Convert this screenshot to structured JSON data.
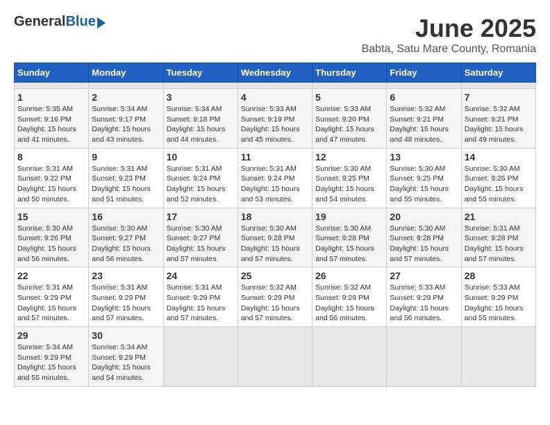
{
  "header": {
    "logo_general": "General",
    "logo_blue": "Blue",
    "month_title": "June 2025",
    "location": "Babta, Satu Mare County, Romania"
  },
  "calendar": {
    "days_of_week": [
      "Sunday",
      "Monday",
      "Tuesday",
      "Wednesday",
      "Thursday",
      "Friday",
      "Saturday"
    ],
    "weeks": [
      [
        {
          "num": "",
          "empty": true
        },
        {
          "num": "",
          "empty": true
        },
        {
          "num": "",
          "empty": true
        },
        {
          "num": "",
          "empty": true
        },
        {
          "num": "",
          "empty": true
        },
        {
          "num": "",
          "empty": true
        },
        {
          "num": "",
          "empty": true
        }
      ],
      [
        {
          "num": "1",
          "sunrise": "Sunrise: 5:35 AM",
          "sunset": "Sunset: 9:16 PM",
          "daylight": "Daylight: 15 hours and 41 minutes."
        },
        {
          "num": "2",
          "sunrise": "Sunrise: 5:34 AM",
          "sunset": "Sunset: 9:17 PM",
          "daylight": "Daylight: 15 hours and 43 minutes."
        },
        {
          "num": "3",
          "sunrise": "Sunrise: 5:34 AM",
          "sunset": "Sunset: 9:18 PM",
          "daylight": "Daylight: 15 hours and 44 minutes."
        },
        {
          "num": "4",
          "sunrise": "Sunrise: 5:33 AM",
          "sunset": "Sunset: 9:19 PM",
          "daylight": "Daylight: 15 hours and 45 minutes."
        },
        {
          "num": "5",
          "sunrise": "Sunrise: 5:33 AM",
          "sunset": "Sunset: 9:20 PM",
          "daylight": "Daylight: 15 hours and 47 minutes."
        },
        {
          "num": "6",
          "sunrise": "Sunrise: 5:32 AM",
          "sunset": "Sunset: 9:21 PM",
          "daylight": "Daylight: 15 hours and 48 minutes."
        },
        {
          "num": "7",
          "sunrise": "Sunrise: 5:32 AM",
          "sunset": "Sunset: 9:21 PM",
          "daylight": "Daylight: 15 hours and 49 minutes."
        }
      ],
      [
        {
          "num": "8",
          "sunrise": "Sunrise: 5:31 AM",
          "sunset": "Sunset: 9:22 PM",
          "daylight": "Daylight: 15 hours and 50 minutes."
        },
        {
          "num": "9",
          "sunrise": "Sunrise: 5:31 AM",
          "sunset": "Sunset: 9:23 PM",
          "daylight": "Daylight: 15 hours and 51 minutes."
        },
        {
          "num": "10",
          "sunrise": "Sunrise: 5:31 AM",
          "sunset": "Sunset: 9:24 PM",
          "daylight": "Daylight: 15 hours and 52 minutes."
        },
        {
          "num": "11",
          "sunrise": "Sunrise: 5:31 AM",
          "sunset": "Sunset: 9:24 PM",
          "daylight": "Daylight: 15 hours and 53 minutes."
        },
        {
          "num": "12",
          "sunrise": "Sunrise: 5:30 AM",
          "sunset": "Sunset: 9:25 PM",
          "daylight": "Daylight: 15 hours and 54 minutes."
        },
        {
          "num": "13",
          "sunrise": "Sunrise: 5:30 AM",
          "sunset": "Sunset: 9:25 PM",
          "daylight": "Daylight: 15 hours and 55 minutes."
        },
        {
          "num": "14",
          "sunrise": "Sunrise: 5:30 AM",
          "sunset": "Sunset: 9:26 PM",
          "daylight": "Daylight: 15 hours and 55 minutes."
        }
      ],
      [
        {
          "num": "15",
          "sunrise": "Sunrise: 5:30 AM",
          "sunset": "Sunset: 9:26 PM",
          "daylight": "Daylight: 15 hours and 56 minutes."
        },
        {
          "num": "16",
          "sunrise": "Sunrise: 5:30 AM",
          "sunset": "Sunset: 9:27 PM",
          "daylight": "Daylight: 15 hours and 56 minutes."
        },
        {
          "num": "17",
          "sunrise": "Sunrise: 5:30 AM",
          "sunset": "Sunset: 9:27 PM",
          "daylight": "Daylight: 15 hours and 57 minutes."
        },
        {
          "num": "18",
          "sunrise": "Sunrise: 5:30 AM",
          "sunset": "Sunset: 9:28 PM",
          "daylight": "Daylight: 15 hours and 57 minutes."
        },
        {
          "num": "19",
          "sunrise": "Sunrise: 5:30 AM",
          "sunset": "Sunset: 9:28 PM",
          "daylight": "Daylight: 15 hours and 57 minutes."
        },
        {
          "num": "20",
          "sunrise": "Sunrise: 5:30 AM",
          "sunset": "Sunset: 9:28 PM",
          "daylight": "Daylight: 15 hours and 57 minutes."
        },
        {
          "num": "21",
          "sunrise": "Sunrise: 5:31 AM",
          "sunset": "Sunset: 9:28 PM",
          "daylight": "Daylight: 15 hours and 57 minutes."
        }
      ],
      [
        {
          "num": "22",
          "sunrise": "Sunrise: 5:31 AM",
          "sunset": "Sunset: 9:29 PM",
          "daylight": "Daylight: 15 hours and 57 minutes."
        },
        {
          "num": "23",
          "sunrise": "Sunrise: 5:31 AM",
          "sunset": "Sunset: 9:29 PM",
          "daylight": "Daylight: 15 hours and 57 minutes."
        },
        {
          "num": "24",
          "sunrise": "Sunrise: 5:31 AM",
          "sunset": "Sunset: 9:29 PM",
          "daylight": "Daylight: 15 hours and 57 minutes."
        },
        {
          "num": "25",
          "sunrise": "Sunrise: 5:32 AM",
          "sunset": "Sunset: 9:29 PM",
          "daylight": "Daylight: 15 hours and 57 minutes."
        },
        {
          "num": "26",
          "sunrise": "Sunrise: 5:32 AM",
          "sunset": "Sunset: 9:29 PM",
          "daylight": "Daylight: 15 hours and 56 minutes."
        },
        {
          "num": "27",
          "sunrise": "Sunrise: 5:33 AM",
          "sunset": "Sunset: 9:29 PM",
          "daylight": "Daylight: 15 hours and 56 minutes."
        },
        {
          "num": "28",
          "sunrise": "Sunrise: 5:33 AM",
          "sunset": "Sunset: 9:29 PM",
          "daylight": "Daylight: 15 hours and 55 minutes."
        }
      ],
      [
        {
          "num": "29",
          "sunrise": "Sunrise: 5:34 AM",
          "sunset": "Sunset: 9:29 PM",
          "daylight": "Daylight: 15 hours and 55 minutes."
        },
        {
          "num": "30",
          "sunrise": "Sunrise: 5:34 AM",
          "sunset": "Sunset: 9:29 PM",
          "daylight": "Daylight: 15 hours and 54 minutes."
        },
        {
          "num": "",
          "empty": true
        },
        {
          "num": "",
          "empty": true
        },
        {
          "num": "",
          "empty": true
        },
        {
          "num": "",
          "empty": true
        },
        {
          "num": "",
          "empty": true
        }
      ]
    ]
  }
}
